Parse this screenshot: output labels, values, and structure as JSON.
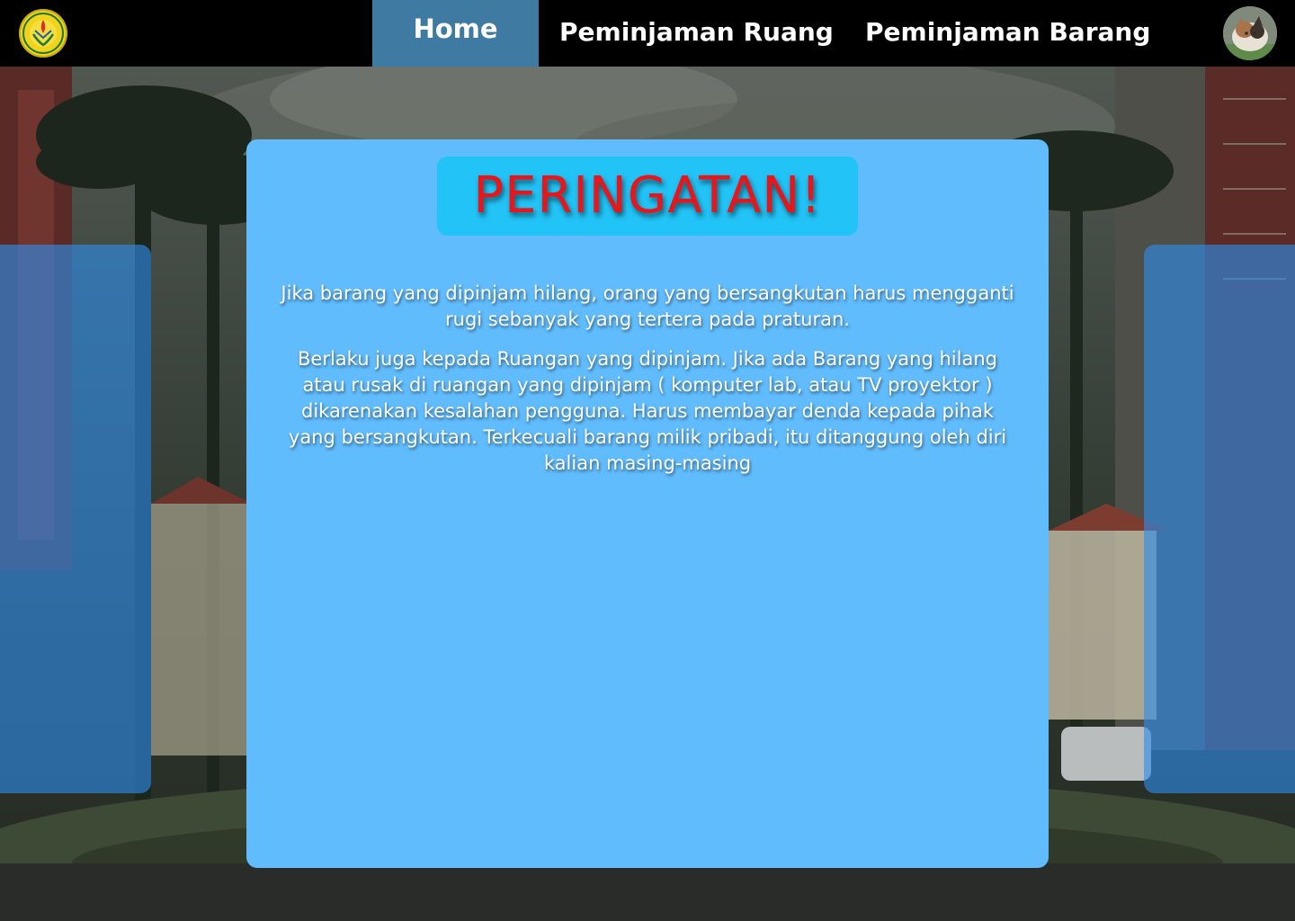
{
  "nav": {
    "logo_icon": "university-logo-icon",
    "home_label": "Home",
    "room_loan_label": "Peminjaman Ruang",
    "item_loan_label": "Peminjaman Barang",
    "avatar_icon": "cat-avatar-icon"
  },
  "notice": {
    "title": "PERINGATAN!",
    "paragraph_1": "Jika barang yang dipinjam hilang, orang yang bersangkutan harus mengganti rugi sebanyak yang tertera pada praturan.",
    "paragraph_2": "Berlaku juga kepada Ruangan yang dipinjam. Jika ada Barang yang hilang atau rusak di ruangan yang dipinjam ( komputer lab, atau TV proyektor ) dikarenakan kesalahan pengguna. Harus membayar denda kepada pihak yang bersangkutan. Terkecuali barang milik pribadi, itu ditanggung oleh diri kalian masing-masing"
  },
  "colors": {
    "navbar": "#000000",
    "nav_active": "#3f7aa3",
    "card": "#61bcfd",
    "title_box": "#22c3f6",
    "title_text": "#e8151b",
    "side_panel": "#2e8ceb"
  }
}
